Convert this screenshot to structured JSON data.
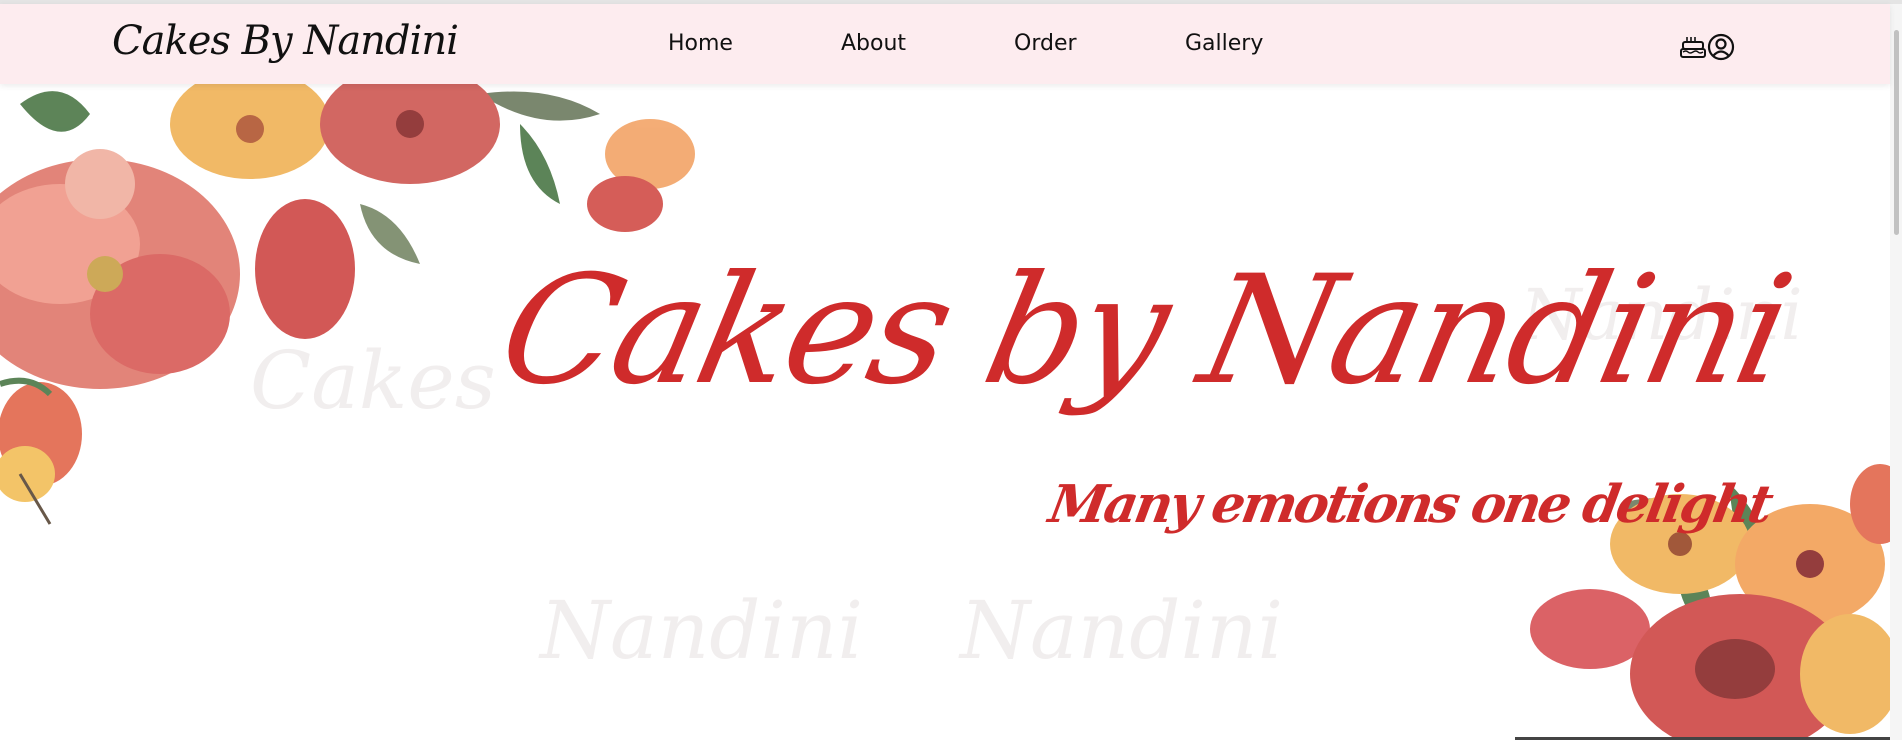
{
  "navbar": {
    "brand": "Cakes By Nandini",
    "links": {
      "home": "Home",
      "about": "About",
      "order": "Order",
      "gallery": "Gallery"
    },
    "icons": [
      "cake-icon",
      "user-circle-icon"
    ]
  },
  "hero": {
    "title": "Cakes by Nandini",
    "tagline": "Many emotions one delight",
    "watermarks": [
      "Cakes",
      "Nandini",
      "Nandini",
      "Nandini"
    ]
  },
  "colors": {
    "navbar_bg": "#fdecef",
    "accent_red": "#cf2b2b",
    "text_dark": "#111111"
  }
}
